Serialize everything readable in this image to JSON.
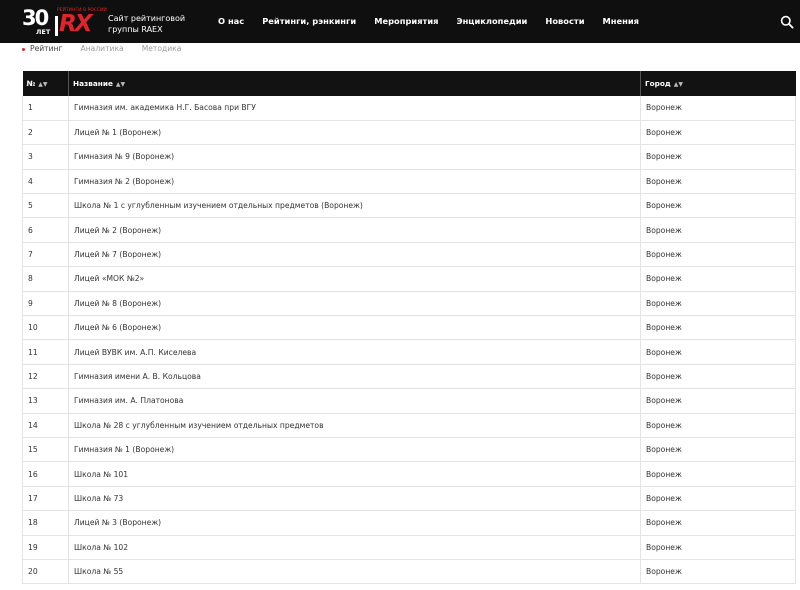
{
  "header": {
    "logo": {
      "number": "30",
      "years": "ЛЕТ",
      "tagline": "РЕЙТИНГИ В РОССИИ",
      "brand": "RX"
    },
    "site_desc_line1": "Сайт рейтинговой",
    "site_desc_line2": "группы RAEX",
    "nav": [
      {
        "label": "О нас"
      },
      {
        "label": "Рейтинги, рэнкинги"
      },
      {
        "label": "Мероприятия"
      },
      {
        "label": "Энциклопедии"
      },
      {
        "label": "Новости"
      },
      {
        "label": "Мнения"
      }
    ],
    "search_icon": "search-icon"
  },
  "subtabs": [
    {
      "label": "Рейтинг",
      "active": true
    },
    {
      "label": "Аналитика",
      "active": false
    },
    {
      "label": "Методика",
      "active": false
    }
  ],
  "table": {
    "columns": [
      {
        "label": "№"
      },
      {
        "label": "Название"
      },
      {
        "label": "Город"
      }
    ],
    "rows": [
      {
        "no": "1",
        "name": "Гимназия им. академика Н.Г. Басова при ВГУ",
        "city": "Воронеж"
      },
      {
        "no": "2",
        "name": "Лицей № 1 (Воронеж)",
        "city": "Воронеж"
      },
      {
        "no": "3",
        "name": "Гимназия № 9 (Воронеж)",
        "city": "Воронеж"
      },
      {
        "no": "4",
        "name": "Гимназия № 2 (Воронеж)",
        "city": "Воронеж"
      },
      {
        "no": "5",
        "name": "Школа № 1 с углубленным изучением отдельных предметов (Воронеж)",
        "city": "Воронеж"
      },
      {
        "no": "6",
        "name": "Лицей № 2 (Воронеж)",
        "city": "Воронеж"
      },
      {
        "no": "7",
        "name": "Лицей № 7 (Воронеж)",
        "city": "Воронеж"
      },
      {
        "no": "8",
        "name": "Лицей «МОК №2»",
        "city": "Воронеж"
      },
      {
        "no": "9",
        "name": "Лицей № 8 (Воронеж)",
        "city": "Воронеж"
      },
      {
        "no": "10",
        "name": "Лицей № 6 (Воронеж)",
        "city": "Воронеж"
      },
      {
        "no": "11",
        "name": "Лицей ВУВК им. А.П. Киселева",
        "city": "Воронеж"
      },
      {
        "no": "12",
        "name": "Гимназия имени А. В. Кольцова",
        "city": "Воронеж"
      },
      {
        "no": "13",
        "name": "Гимназия им. А. Платонова",
        "city": "Воронеж"
      },
      {
        "no": "14",
        "name": "Школа № 28 с углубленным изучением отдельных предметов",
        "city": "Воронеж"
      },
      {
        "no": "15",
        "name": "Гимназия № 1 (Воронеж)",
        "city": "Воронеж"
      },
      {
        "no": "16",
        "name": "Школа № 101",
        "city": "Воронеж"
      },
      {
        "no": "17",
        "name": "Школа № 73",
        "city": "Воронеж"
      },
      {
        "no": "18",
        "name": "Лицей № 3 (Воронеж)",
        "city": "Воронеж"
      },
      {
        "no": "19",
        "name": "Школа № 102",
        "city": "Воронеж"
      },
      {
        "no": "20",
        "name": "Школа № 55",
        "city": "Воронеж"
      }
    ]
  },
  "colors": {
    "accent": "#e32229",
    "header_bg": "#0f0f0f"
  }
}
